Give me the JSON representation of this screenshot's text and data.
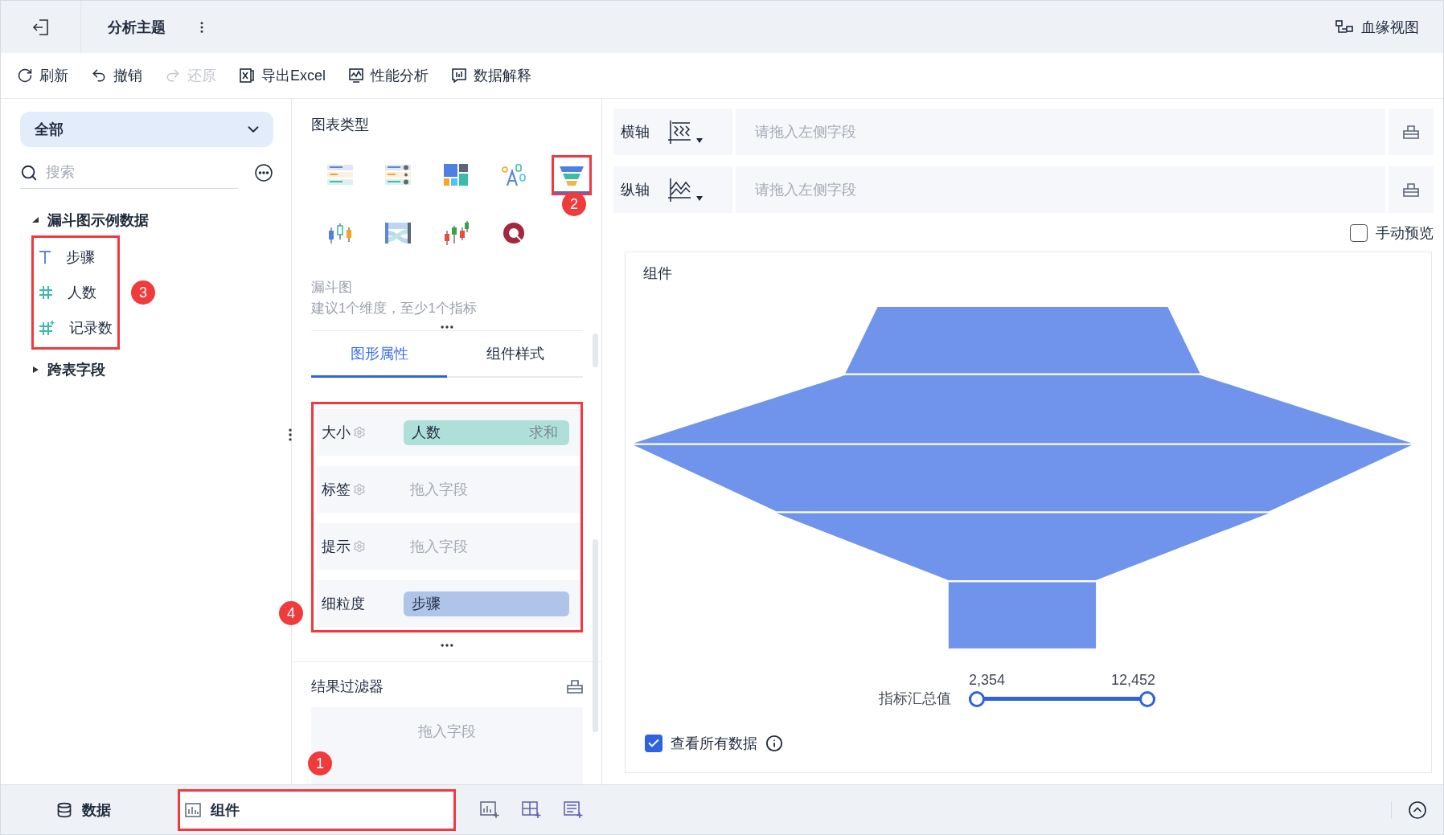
{
  "header": {
    "title": "分析主题",
    "lineage": "血缘视图"
  },
  "toolbar": [
    {
      "label": "刷新",
      "kind": "refresh",
      "disabled": false
    },
    {
      "label": "撤销",
      "kind": "undo",
      "disabled": false
    },
    {
      "label": "还原",
      "kind": "redo",
      "disabled": true
    },
    {
      "label": "导出Excel",
      "kind": "excel",
      "disabled": false
    },
    {
      "label": "性能分析",
      "kind": "performance",
      "disabled": false
    },
    {
      "label": "数据解释",
      "kind": "explain",
      "disabled": false
    }
  ],
  "data_panel": {
    "scope": "全部",
    "search": {
      "placeholder": "搜索"
    },
    "tree": [
      {
        "label": "漏斗图示例数据",
        "expanded": true,
        "children": [
          {
            "label": "步骤",
            "kind": "text"
          },
          {
            "label": "人数",
            "kind": "number"
          },
          {
            "label": "记录数",
            "kind": "count"
          }
        ]
      },
      {
        "label": "跨表字段",
        "expanded": false
      }
    ]
  },
  "chart_panel": {
    "title": "图表类型",
    "chart_types": [
      {
        "kind": "ranked-list",
        "selected": false
      },
      {
        "kind": "dot-list",
        "selected": false
      },
      {
        "kind": "treemap",
        "selected": false
      },
      {
        "kind": "word-cloud",
        "selected": false
      },
      {
        "kind": "funnel",
        "selected": true
      },
      {
        "kind": "boxplot",
        "selected": false
      },
      {
        "kind": "sankey",
        "selected": false
      },
      {
        "kind": "candlestick",
        "selected": false
      },
      {
        "kind": "ring",
        "selected": false
      }
    ],
    "description": {
      "name": "漏斗图",
      "hint": "建议1个维度，至少1个指标"
    },
    "tabs": [
      {
        "label": "图形属性",
        "selected": true
      },
      {
        "label": "组件样式",
        "selected": false
      }
    ],
    "properties": [
      {
        "label": "大小",
        "settings": true,
        "kind": "measure",
        "field": "人数",
        "aggregate": "求和"
      },
      {
        "label": "标签",
        "settings": true,
        "kind": "empty",
        "placeholder": "拖入字段"
      },
      {
        "label": "提示",
        "settings": true,
        "kind": "empty",
        "placeholder": "拖入字段"
      },
      {
        "label": "细粒度",
        "settings": false,
        "kind": "dimension",
        "field": "步骤"
      }
    ],
    "filter": {
      "title": "结果过滤器",
      "placeholder": "拖入字段"
    }
  },
  "axes": [
    {
      "label": "横轴",
      "kind": "x",
      "placeholder": "请拖入左侧字段"
    },
    {
      "label": "纵轴",
      "kind": "y",
      "placeholder": "请拖入左侧字段"
    }
  ],
  "manual_preview": {
    "label": "手动预览",
    "checked": false
  },
  "component": {
    "title": "组件",
    "range": {
      "label": "指标汇总值",
      "min": "2,354",
      "max": "12,452",
      "level": 1
    },
    "view_all": {
      "label": "查看所有数据",
      "checked": true
    }
  },
  "bottom_tabs": [
    {
      "label": "数据",
      "kind": "data",
      "selected": false
    },
    {
      "label": "组件",
      "kind": "component",
      "selected": true
    }
  ],
  "annotations": [
    {
      "label": "1"
    },
    {
      "label": "2"
    },
    {
      "label": "3"
    },
    {
      "label": "4"
    }
  ]
}
